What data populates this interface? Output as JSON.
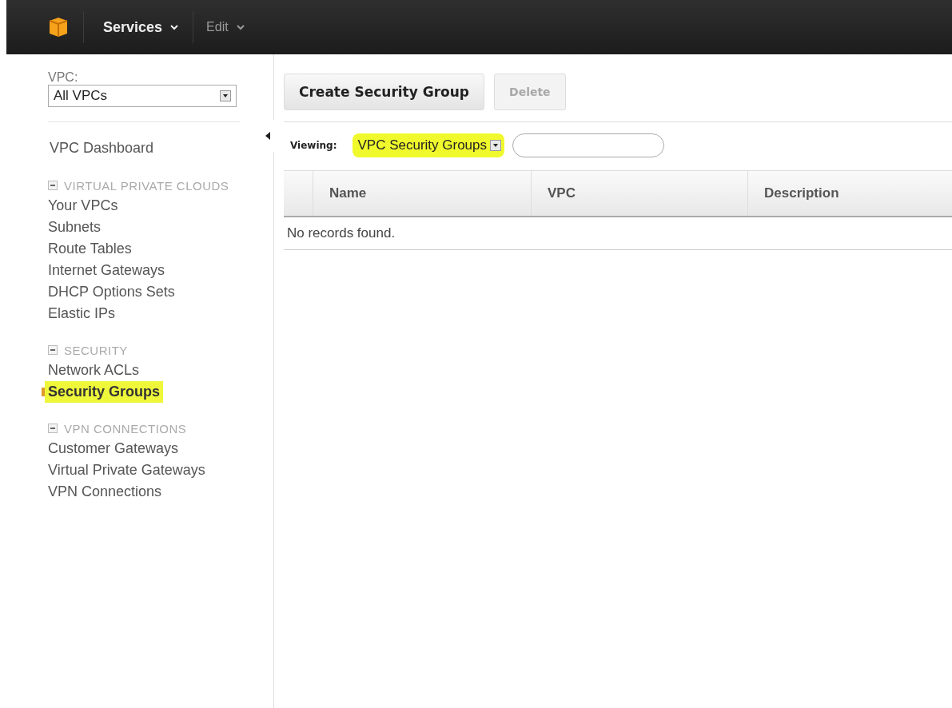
{
  "top_bar": {
    "menus": [
      {
        "label": "Services"
      },
      {
        "label": "Edit"
      }
    ]
  },
  "sidebar": {
    "vpc_filter": {
      "label": "VPC:",
      "value": "All VPCs"
    },
    "dashboard": {
      "label": "VPC Dashboard"
    },
    "sections": [
      {
        "title": "VIRTUAL PRIVATE CLOUDS",
        "expanded": true,
        "items": [
          {
            "label": "Your VPCs",
            "selected": false
          },
          {
            "label": "Subnets",
            "selected": false
          },
          {
            "label": "Route Tables",
            "selected": false
          },
          {
            "label": "Internet Gateways",
            "selected": false
          },
          {
            "label": "DHCP Options Sets",
            "selected": false
          },
          {
            "label": "Elastic IPs",
            "selected": false
          }
        ]
      },
      {
        "title": "SECURITY",
        "expanded": true,
        "items": [
          {
            "label": "Network ACLs",
            "selected": false
          },
          {
            "label": "Security Groups",
            "selected": true
          }
        ]
      },
      {
        "title": "VPN CONNECTIONS",
        "expanded": true,
        "items": [
          {
            "label": "Customer Gateways",
            "selected": false
          },
          {
            "label": "Virtual Private Gateways",
            "selected": false
          },
          {
            "label": "VPN Connections",
            "selected": false
          }
        ]
      }
    ]
  },
  "toolbar": {
    "buttons": [
      {
        "label": "Create Security Group",
        "disabled": false
      },
      {
        "label": "Delete",
        "disabled": true
      }
    ]
  },
  "filter": {
    "label": "Viewing:",
    "value": "VPC Security Groups",
    "highlighted": true
  },
  "table": {
    "columns": [
      "Name",
      "VPC",
      "Description"
    ],
    "empty_message": "No records found."
  }
}
